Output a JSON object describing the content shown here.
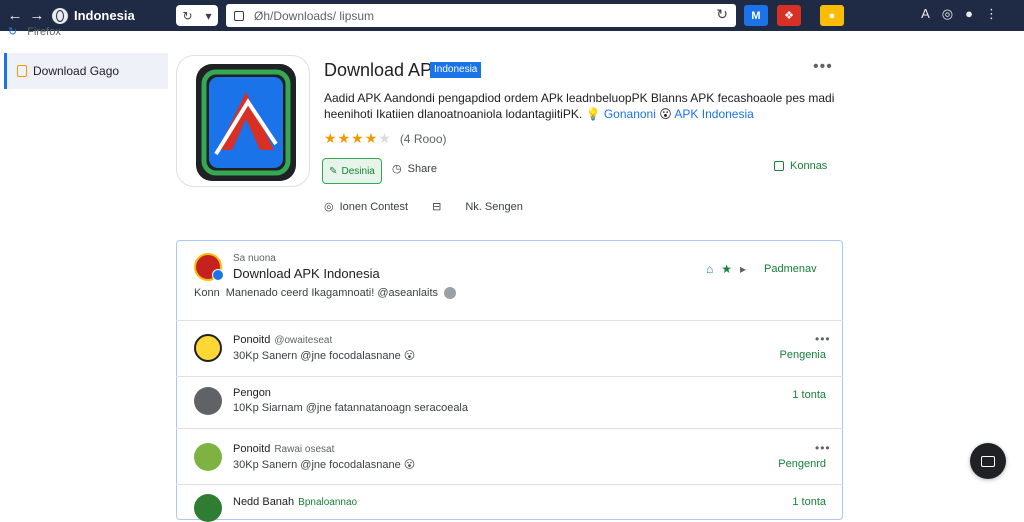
{
  "browser": {
    "back": "←",
    "forward": "→",
    "tab_title": "Indonesia",
    "nav_back": "↻",
    "nav_menu": "▾",
    "url": "Øh/Downloads/ lipsum",
    "reload": "↻",
    "ext1": "M",
    "ext2": "❖",
    "ext3": "●",
    "ext1_color": "#1a73e8",
    "ext2_color": "#d93025",
    "ext3_color": "#fbbc04",
    "right_icons": [
      "A",
      "◎",
      "●",
      "⋮"
    ]
  },
  "sidebar": {
    "top_label": "Firefox",
    "active_item": "Download Gago"
  },
  "app": {
    "title": "Download APK",
    "badge": "Indonesia",
    "more": "•••",
    "desc_line1": "Aadid APK Aandondi pengapdiod ordem APk leadnbeluopPK Blanns APK fecashoaole pes madi",
    "desc_line2": "heenihoti Ikatiien dlanoatnoaniola lodantagiitiPK.",
    "desc_link1": "Gonanoni",
    "desc_link2": "APK Indonesia",
    "rating_stars": 4,
    "rating_count": "(4 Rooo)",
    "install_label": "Desinia",
    "share_label": "Share",
    "download_label": "Konnas",
    "meta_item1": "Ionen Contest",
    "meta_item2": "Nk. Sengen"
  },
  "card": {
    "subtitle": "Sa nuona",
    "title": "Download APK Indonesia",
    "action_label": "Padmenav",
    "desc_prefix": "Konn",
    "desc_text": "Manenado ceerd Ikagamnoati! @aseanlaits"
  },
  "comments": [
    {
      "name": "Ponoitd",
      "handle": "@owaiteseat",
      "text": "30Kp Sanern @jne focodalasnane 😮",
      "action": "Pengenia",
      "avatar_color": "#fdd835",
      "has_more": true
    },
    {
      "name": "Pengon",
      "handle": "",
      "text": "10Kp Siarnam @jne fatannatanoagn seracoeala",
      "action": "1 tonta",
      "avatar_color": "#5f6368",
      "has_more": false
    },
    {
      "name": "Ponoitd",
      "handle": "Rawai osesat",
      "text": "30Kp Sanern @jne focodalasnane 😮",
      "action": "Pengenrd",
      "avatar_color": "#7cb342",
      "has_more": true
    },
    {
      "name": "Nedd Banah",
      "handle": "Bpnaloannao",
      "text": "",
      "action": "1 tonta",
      "avatar_color": "#2e7d32",
      "has_more": false
    }
  ]
}
